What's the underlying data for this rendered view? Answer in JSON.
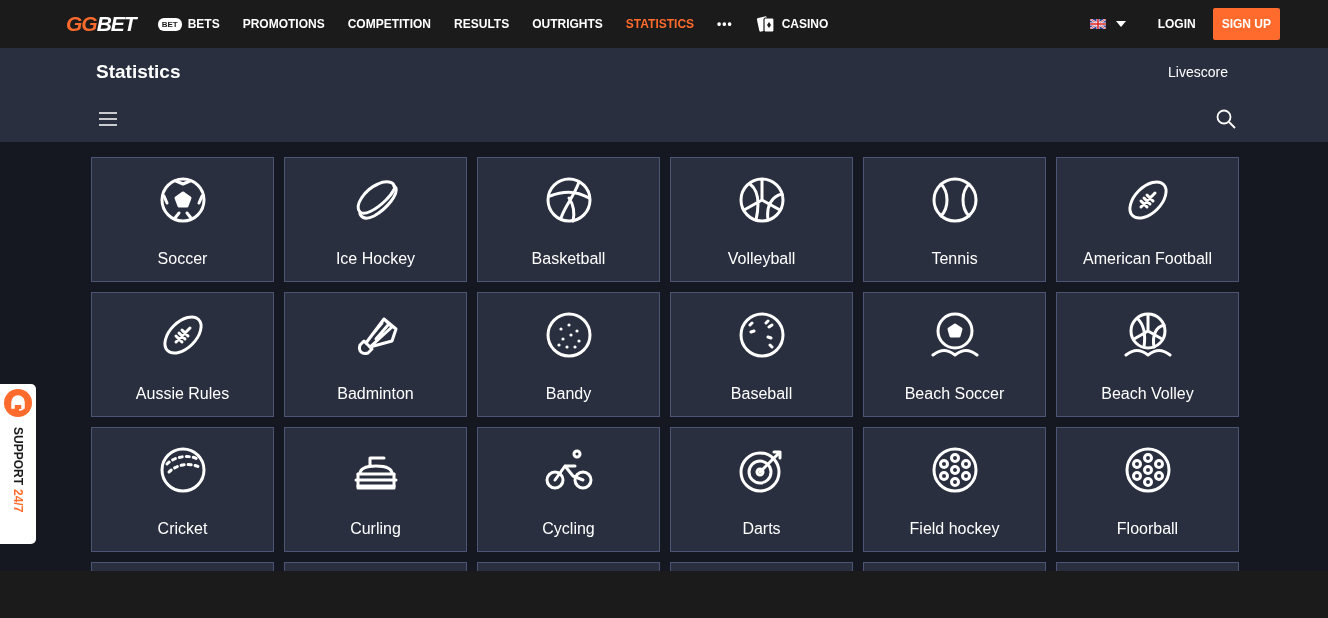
{
  "logo": {
    "first": "GG",
    "second": "BET"
  },
  "nav": [
    {
      "label": "BETS",
      "badge": "BET",
      "kind": "badge",
      "selected": false
    },
    {
      "label": "PROMOTIONS",
      "kind": "plain",
      "selected": false
    },
    {
      "label": "COMPETITION",
      "kind": "plain",
      "selected": false
    },
    {
      "label": "RESULTS",
      "kind": "plain",
      "selected": false
    },
    {
      "label": "OUTRIGHTS",
      "kind": "plain",
      "selected": false
    },
    {
      "label": "STATISTICS",
      "kind": "plain",
      "selected": true
    },
    {
      "label": "•••",
      "kind": "more",
      "selected": false
    },
    {
      "label": "CASINO",
      "kind": "cards",
      "selected": false
    }
  ],
  "auth": {
    "login": "LOGIN",
    "signup": "SIGN UP"
  },
  "page": {
    "title": "Statistics",
    "livescore": "Livescore"
  },
  "sports": [
    {
      "name": "Soccer",
      "kind": "soccer"
    },
    {
      "name": "Ice Hockey",
      "kind": "puck"
    },
    {
      "name": "Basketball",
      "kind": "basketball"
    },
    {
      "name": "Volleyball",
      "kind": "volleyball"
    },
    {
      "name": "Tennis",
      "kind": "tennis"
    },
    {
      "name": "American Football",
      "kind": "football"
    },
    {
      "name": "Aussie Rules",
      "kind": "football"
    },
    {
      "name": "Badminton",
      "kind": "shuttlecock"
    },
    {
      "name": "Bandy",
      "kind": "dotted"
    },
    {
      "name": "Baseball",
      "kind": "baseball"
    },
    {
      "name": "Beach Soccer",
      "kind": "beach-soccer"
    },
    {
      "name": "Beach Volley",
      "kind": "beach-volley"
    },
    {
      "name": "Cricket",
      "kind": "cricket"
    },
    {
      "name": "Curling",
      "kind": "curling"
    },
    {
      "name": "Cycling",
      "kind": "cycling"
    },
    {
      "name": "Darts",
      "kind": "darts"
    },
    {
      "name": "Field hockey",
      "kind": "holes"
    },
    {
      "name": "Floorball",
      "kind": "holes"
    }
  ],
  "support": {
    "label": "SUPPORT",
    "hours": "24/7"
  }
}
